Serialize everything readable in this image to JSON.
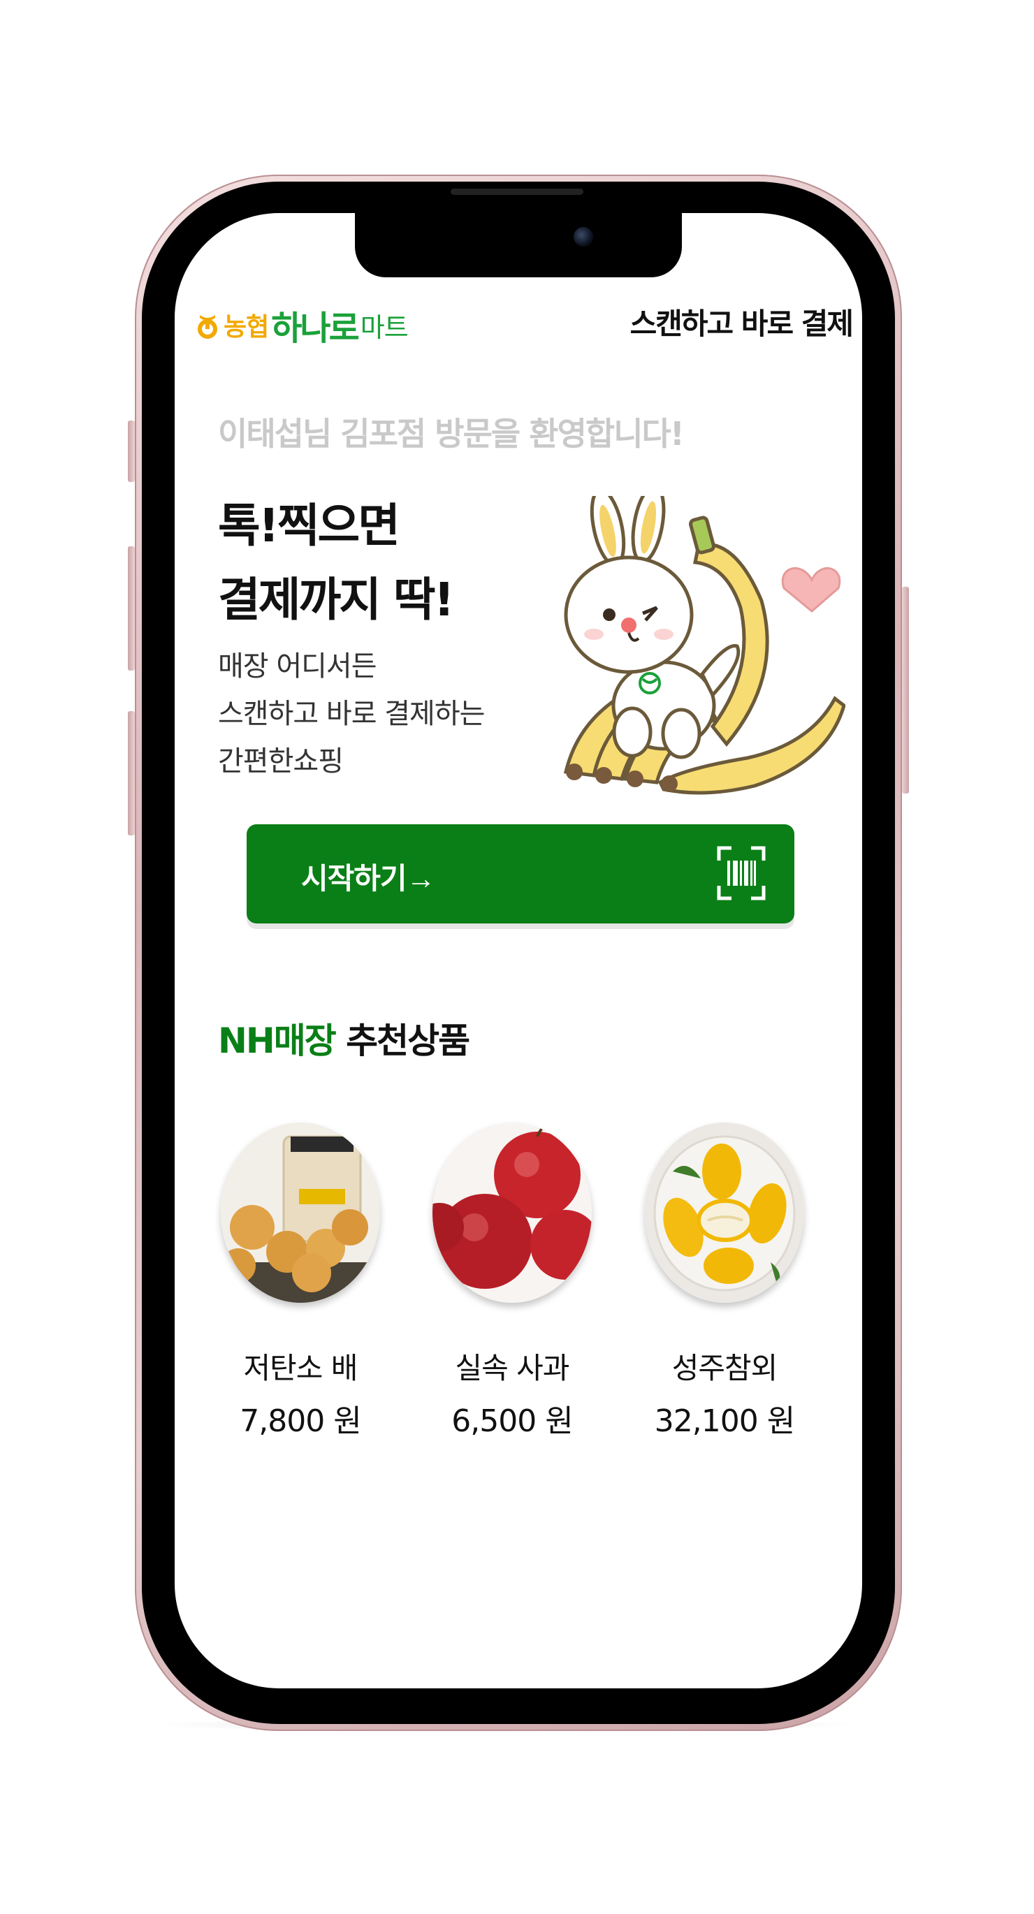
{
  "header": {
    "logo": {
      "nh": "농협",
      "hanaro": "하나로",
      "mart": "마트"
    },
    "title": "스캔하고 바로 결제"
  },
  "hero": {
    "welcome": "이태섭님 김포점 방문을 환영합니다!",
    "headline": [
      "톡!찍으면",
      "결제까지 딱!"
    ],
    "subcopy": [
      "매장 어디서든",
      "스캔하고 바로 결제하는",
      "간편한쇼핑"
    ],
    "mascot": "rabbit-banana-mascot"
  },
  "start_button": {
    "label": "시작하기→",
    "icon": "barcode-scan-icon"
  },
  "recommendations": {
    "heading_accent": "NH매장",
    "heading_rest": " 추천상품",
    "items": [
      {
        "name": "저탄소 배",
        "price": "7,800 원",
        "image": "pear-image"
      },
      {
        "name": "실속 사과",
        "price": "6,500 원",
        "image": "apple-image"
      },
      {
        "name": "성주참외",
        "price": "32,100 원",
        "image": "korean-melon-image"
      }
    ]
  },
  "colors": {
    "primary_green": "#0a7f17",
    "logo_green": "#1aa13a",
    "logo_yellow": "#f2a900",
    "welcome_gray": "#c9c9c9"
  }
}
